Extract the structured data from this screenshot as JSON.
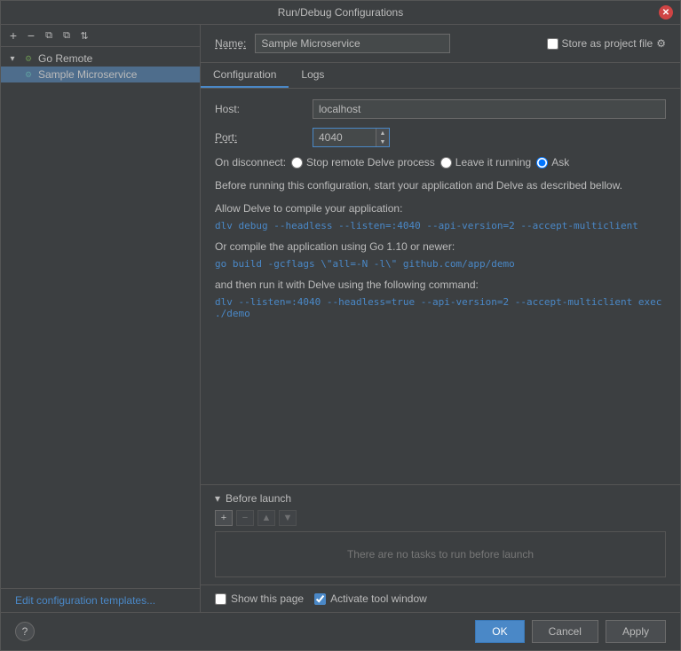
{
  "dialog": {
    "title": "Run/Debug Configurations"
  },
  "sidebar": {
    "toolbar": {
      "add_label": "+",
      "remove_label": "−",
      "copy_label": "⧉",
      "move_label": "⧉",
      "sort_label": "⇅"
    },
    "tree": {
      "group_name": "Go Remote",
      "child_name": "Sample Microservice"
    },
    "edit_templates": "Edit configuration templates..."
  },
  "header": {
    "name_label": "Name:",
    "name_value": "Sample Microservice",
    "store_label": "Store as project file"
  },
  "tabs": [
    {
      "label": "Configuration",
      "active": true
    },
    {
      "label": "Logs",
      "active": false
    }
  ],
  "configuration": {
    "host_label": "Host:",
    "host_value": "localhost",
    "port_label": "Port:",
    "port_value": "4040",
    "on_disconnect_label": "On disconnect:",
    "radio_options": [
      {
        "label": "Stop remote Delve process",
        "selected": false
      },
      {
        "label": "Leave it running",
        "selected": false
      },
      {
        "label": "Ask",
        "selected": true
      }
    ],
    "info_text": "Before running this configuration, start your application and Delve as described bellow.",
    "section1_title": "Allow Delve to compile your application:",
    "section1_code": "dlv debug --headless --listen=:4040 --api-version=2 --accept-multiclient",
    "section2_title": "Or compile the application using Go 1.10 or newer:",
    "section2_code": "go build -gcflags \\\"all=-N -l\\\" github.com/app/demo",
    "section3_title": "and then run it with Delve using the following command:",
    "section3_code": "dlv --listen=:4040 --headless=true --api-version=2 --accept-multiclient exec ./demo"
  },
  "before_launch": {
    "label": "Before launch",
    "no_tasks": "There are no tasks to run before launch"
  },
  "bottom": {
    "show_page_label": "Show this page",
    "activate_window_label": "Activate tool window",
    "show_page_checked": false,
    "activate_window_checked": true
  },
  "footer": {
    "ok_label": "OK",
    "cancel_label": "Cancel",
    "apply_label": "Apply",
    "help_label": "?"
  }
}
